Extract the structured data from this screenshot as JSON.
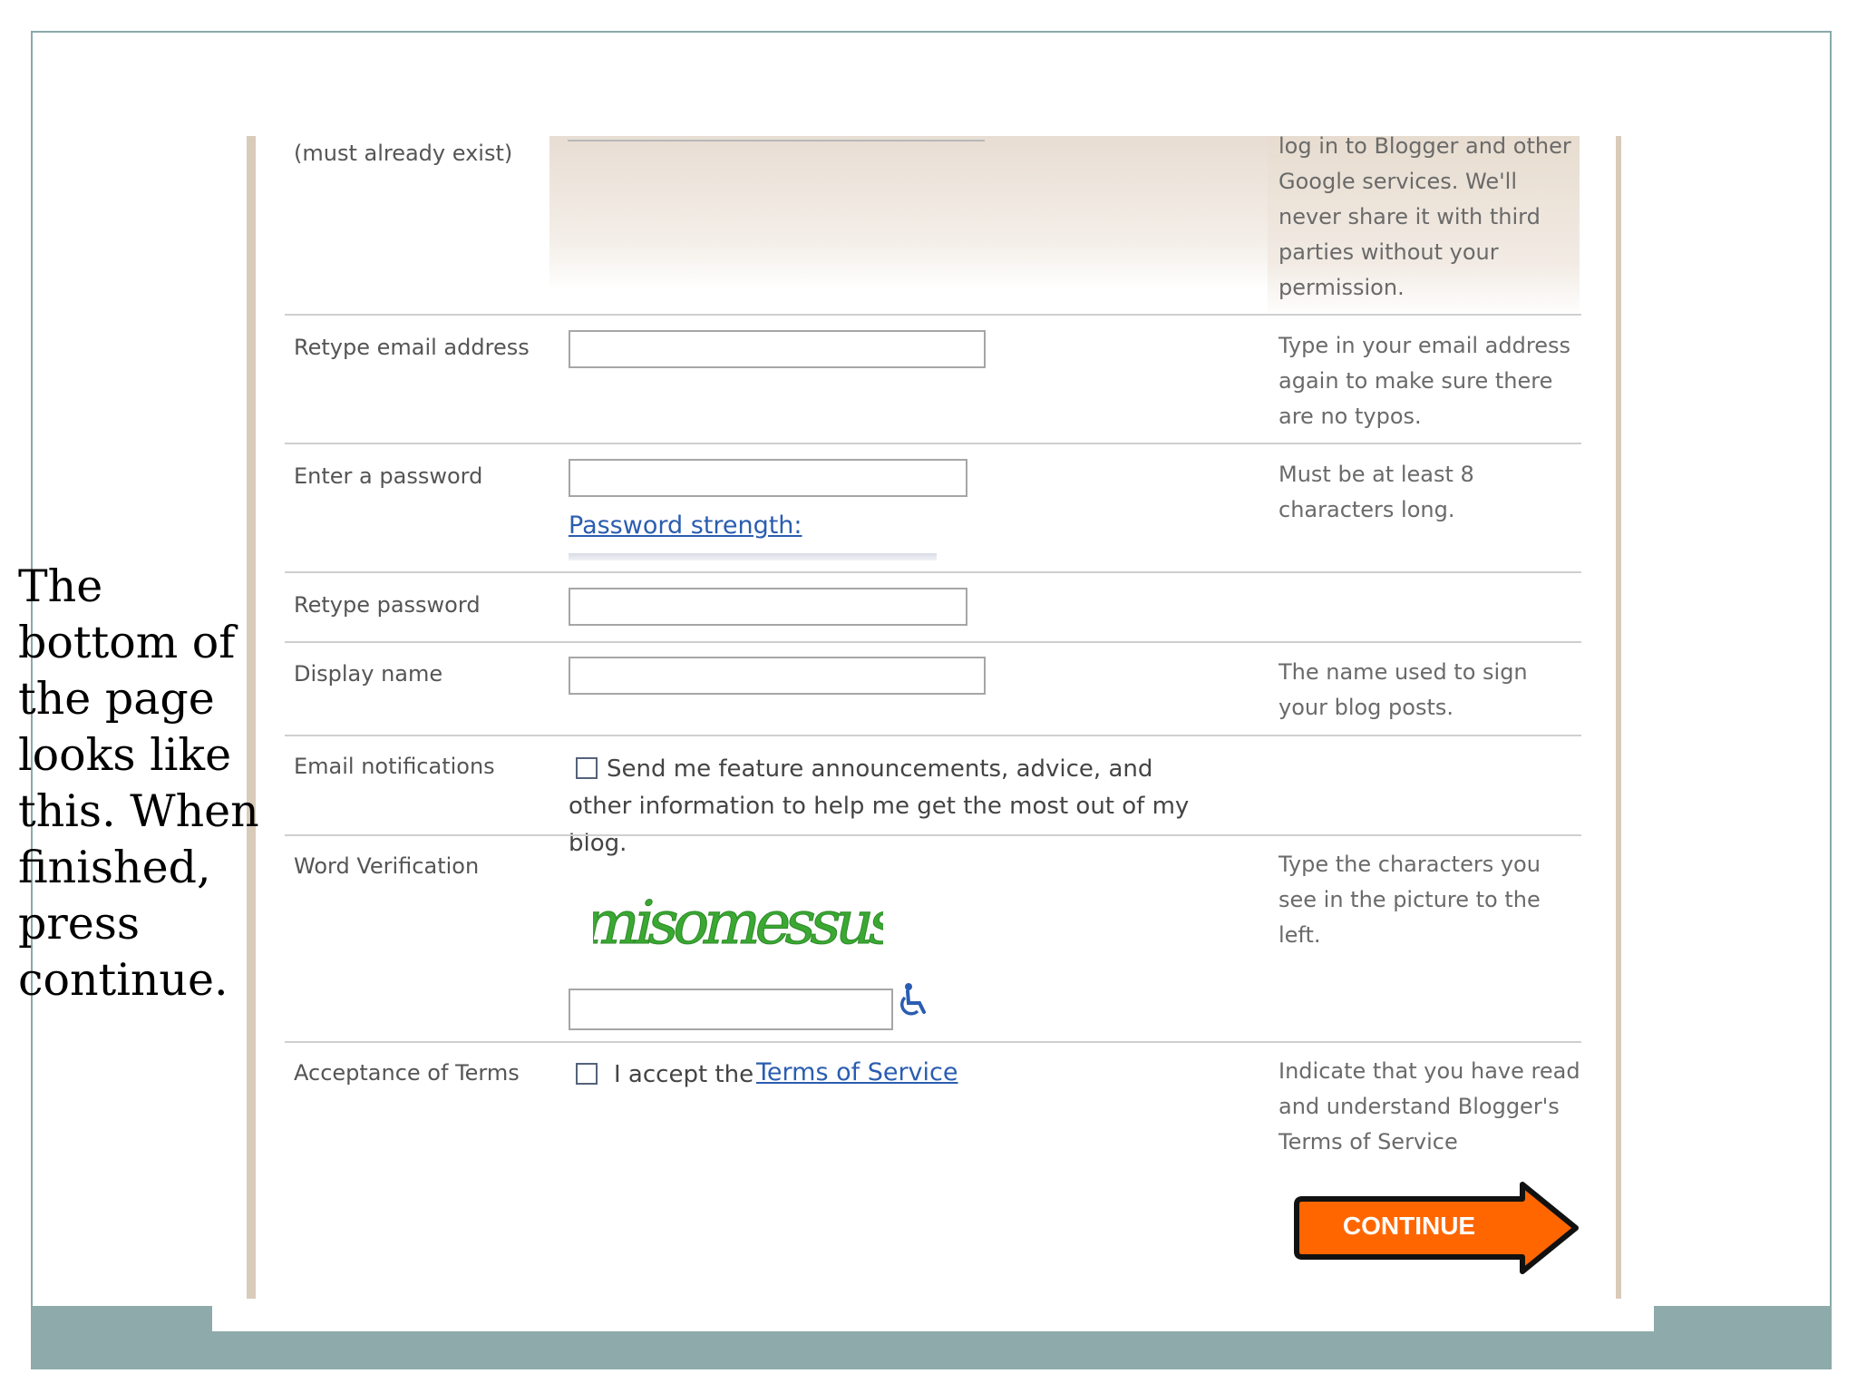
{
  "caption": {
    "text": "The bottom of the page looks like this.  When finished, press continue."
  },
  "form": {
    "email_sub_label": "(must already exist)",
    "email_help": "log in to Blogger and other Google services. We'll never share it with third parties without your permission.",
    "retype_email": {
      "label": "Retype email address",
      "value": "",
      "help": "Type in your email address again to make sure there are no typos."
    },
    "password": {
      "label": "Enter a password",
      "value": "",
      "strength_link": "Password strength:",
      "help": "Must be at least 8 characters long."
    },
    "retype_password": {
      "label": "Retype password",
      "value": ""
    },
    "display_name": {
      "label": "Display name",
      "value": "",
      "help": "The name used to sign your blog posts."
    },
    "email_notifications": {
      "label": "Email notifications",
      "checkbox_text": "Send me feature announcements, advice, and other information to help me get the most out of my blog.",
      "checked": false
    },
    "word_verification": {
      "label": "Word Verification",
      "captcha_text": "misomessus",
      "value": "",
      "help": "Type the characters you see in the picture to the left."
    },
    "terms": {
      "label": "Acceptance of Terms",
      "checkbox_prefix": "I accept the",
      "link_text": "Terms of Service",
      "checked": false,
      "help": "Indicate that you have read and understand Blogger's Terms of Service"
    },
    "continue_label": "CONTINUE"
  },
  "colors": {
    "accent_orange": "#ff6600",
    "link_blue": "#2a5db0",
    "captcha_green": "#3aa832",
    "slide_teal": "#8eaaaa"
  },
  "icons": {
    "accessibility": "wheelchair-icon",
    "continue_arrow": "right-arrow-icon"
  }
}
